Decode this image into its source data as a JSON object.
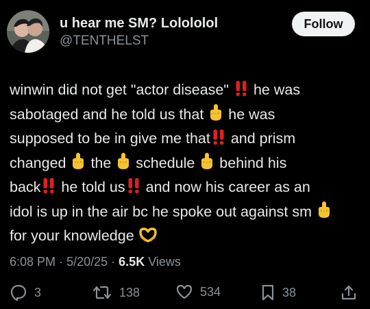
{
  "tweet": {
    "display_name": "u hear me SM? Lolololol",
    "handle": "@TENTHELST",
    "follow_label": "Follow",
    "body": {
      "l1a": "winwin did not get \"actor disease\" ",
      "l1b": " he was",
      "l2a": "sabotaged and he told us that ",
      "l2b": " he was",
      "l3a": "supposed to be in give me that",
      "l3b": " and prism",
      "l4a": "changed ",
      "l4b": " the ",
      "l4c": " schedule ",
      "l4d": " behind his",
      "l5a": "back",
      "l5b": " he told us",
      "l5c": " and now his career as an",
      "l6a": "idol is up in the air bc he spoke out against sm ",
      "l7a": "for your knowledge "
    },
    "emoji": {
      "double_exclamation": "double-exclamation-icon",
      "pointing_finger": "middle-finger-icon",
      "heart_hands": "heart-hands-icon"
    },
    "time": "6:08 PM",
    "date": "5/20/25",
    "views_count": "6.5K",
    "views_label": "Views",
    "separator": "·"
  },
  "actions": {
    "replies": "3",
    "reposts": "138",
    "likes": "534",
    "bookmarks": "38"
  },
  "colors": {
    "background": "#000000",
    "text": "#e7e9ea",
    "muted": "#8b9298",
    "emoji_red": "#e0201c",
    "emoji_yellow": "#f6c230"
  }
}
